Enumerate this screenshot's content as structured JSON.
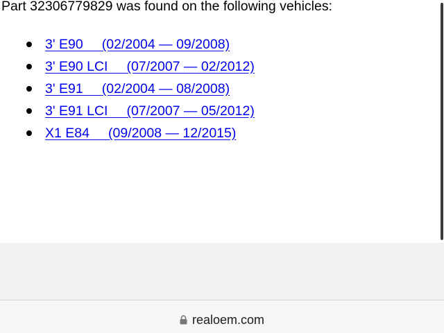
{
  "page": {
    "headline": "Part 32306779829 was found on the following vehicles:",
    "vehicles": [
      {
        "label": "3' E90     (02/2004 — 09/2008)"
      },
      {
        "label": "3' E90 LCI     (07/2007 — 02/2012)"
      },
      {
        "label": "3' E91     (02/2004 — 08/2008)"
      },
      {
        "label": "3' E91 LCI     (07/2007 — 05/2012)"
      },
      {
        "label": "X1 E84     (09/2008 — 12/2015)"
      }
    ],
    "link_color": "#0000ee"
  },
  "browser": {
    "url": "realoem.com",
    "url_icon": "lock-icon"
  }
}
